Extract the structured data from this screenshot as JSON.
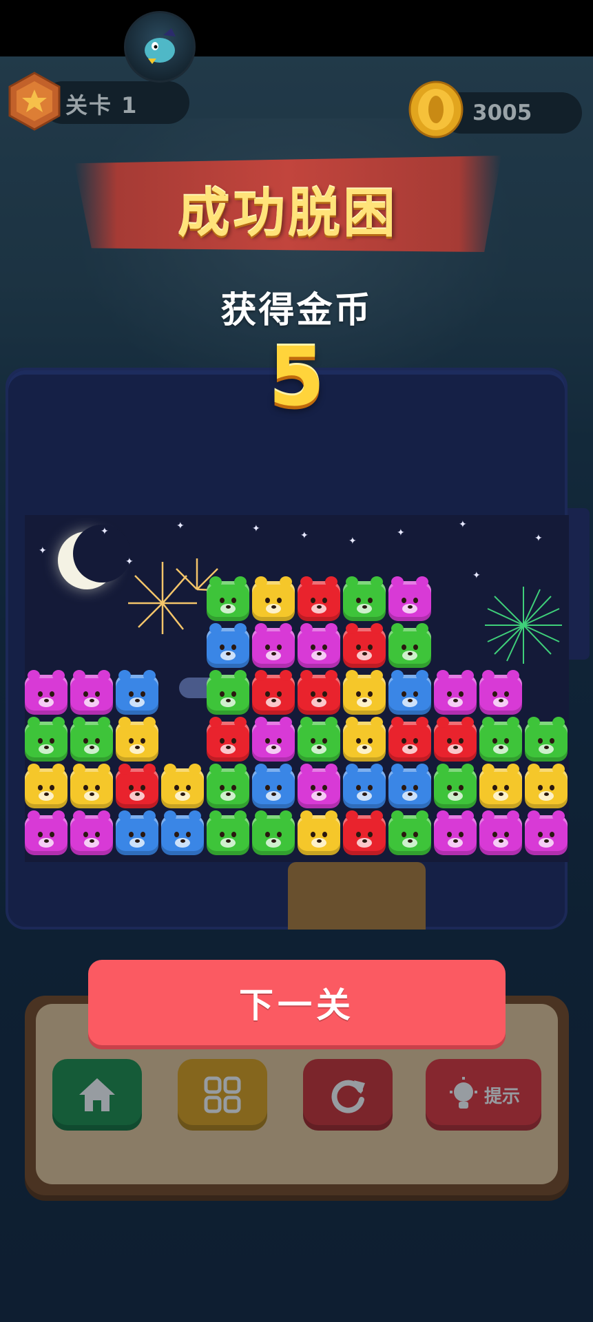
{
  "header": {
    "level_label": "关卡 1",
    "coins": "3005"
  },
  "result": {
    "title": "成功脱困",
    "reward_label": "获得金币",
    "reward_amount": "5"
  },
  "actions": {
    "next_level": "下一关"
  },
  "toolbar": {
    "hint_label": "提示",
    "home_color": "#1f8f4a",
    "grid_color": "#e0a21c",
    "refresh_color": "#cf3234",
    "hint_color": "#e2363c"
  },
  "icons": {
    "avatar": "dragon-avatar-icon",
    "level": "star-badge-icon",
    "coin": "gold-coin-icon",
    "home": "home-icon",
    "grid": "grid-icon",
    "refresh": "refresh-icon",
    "hint": "lightbulb-icon"
  },
  "colors": {
    "green": "#3ec43a",
    "yellow": "#f5c72a",
    "red": "#e9232d",
    "pink": "#d83ad6",
    "blue": "#3a86e6"
  },
  "board": {
    "rows": [
      "....GYRGP..",
      "....BPPRG..",
      "PPB.GRRYBPP",
      "GGY.RPGYRRG",
      "YYRYGBPBBGY",
      "PPBBGGYRGPP"
    ],
    "row_extras": [
      "",
      "",
      "",
      "G",
      "Y",
      "P"
    ]
  }
}
